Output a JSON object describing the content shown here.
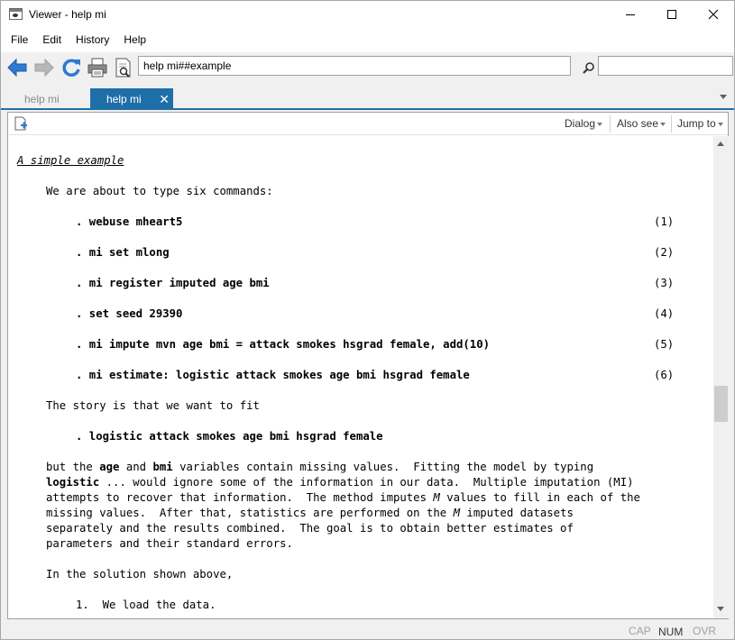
{
  "window": {
    "title": "Viewer - help mi"
  },
  "menu": [
    "File",
    "Edit",
    "History",
    "Help"
  ],
  "toolbar": {
    "url": "help mi##example",
    "find_value": ""
  },
  "tabs": [
    {
      "label": "help mi",
      "active": false
    },
    {
      "label": "help mi",
      "active": true
    }
  ],
  "content_toolbar": {
    "dialog": "Dialog",
    "also_see": "Also see",
    "jump_to": "Jump to"
  },
  "doc": {
    "heading": "A simple example",
    "intro": "We are about to type six commands:",
    "commands": [
      {
        "text": ". webuse mheart5",
        "num": "(1)"
      },
      {
        "text": ". mi set mlong",
        "num": "(2)"
      },
      {
        "text": ". mi register imputed age bmi",
        "num": "(3)"
      },
      {
        "text": ". set seed 29390",
        "num": "(4)"
      },
      {
        "text": ". mi impute mvn age bmi = attack smokes hsgrad female, add(10)",
        "num": "(5)"
      },
      {
        "text": ". mi estimate: logistic attack smokes age bmi hsgrad female",
        "num": "(6)"
      }
    ],
    "story": "The story is that we want to fit",
    "fit_cmd": ". logistic attack smokes age bmi hsgrad female",
    "para": {
      "l1_a": "but the ",
      "l1_age": "age",
      "l1_b": " and ",
      "l1_bmi": "bmi",
      "l1_c": " variables contain missing values.  Fitting the model by typing",
      "l2_logistic": "logistic",
      "l2_rest": " ... would ignore some of the information in our data.  Multiple imputation (MI)",
      "l3_a": "attempts to recover that information.  The method imputes ",
      "l3_M": "M",
      "l3_b": " values to fill in each of the",
      "l4_a": "missing values.  After that, statistics are performed on the ",
      "l4_M": "M",
      "l4_b": " imputed datasets",
      "l5": "separately and the results combined.  The goal is to obtain better estimates of",
      "l6": "parameters and their standard errors."
    },
    "solution": "In the solution shown above,",
    "step1": "1.  We load the data."
  },
  "status": {
    "cap": "CAP",
    "num": "NUM",
    "ovr": "OVR"
  }
}
